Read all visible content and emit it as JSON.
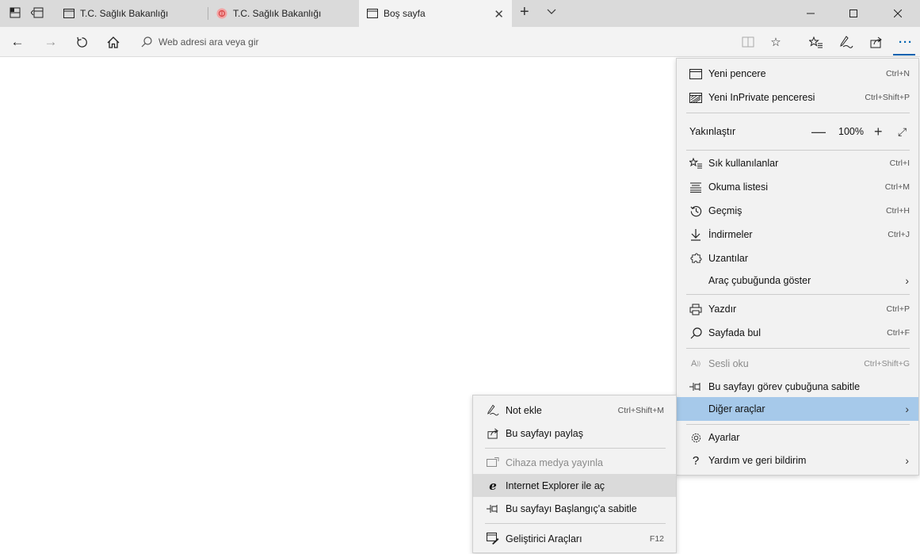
{
  "tabbar": {
    "tabs": [
      {
        "title": "T.C. Sağlık Bakanlığı"
      },
      {
        "title": "T.C. Sağlık Bakanlığı"
      },
      {
        "title": "Boş sayfa"
      }
    ],
    "accent_color": "#0063b1"
  },
  "address": {
    "placeholder": "Web adresi ara veya gir"
  },
  "menu": {
    "new_window": {
      "label": "Yeni pencere",
      "shortcut": "Ctrl+N"
    },
    "inprivate": {
      "label": "Yeni InPrivate penceresi",
      "shortcut": "Ctrl+Shift+P"
    },
    "zoom": {
      "label": "Yakınlaştır",
      "value": "100%"
    },
    "favorites": {
      "label": "Sık kullanılanlar",
      "shortcut": "Ctrl+I"
    },
    "reading_list": {
      "label": "Okuma listesi",
      "shortcut": "Ctrl+M"
    },
    "history": {
      "label": "Geçmiş",
      "shortcut": "Ctrl+H"
    },
    "downloads": {
      "label": "İndirmeler",
      "shortcut": "Ctrl+J"
    },
    "extensions": {
      "label": "Uzantılar"
    },
    "show_in_toolbar": {
      "label": "Araç çubuğunda göster"
    },
    "print": {
      "label": "Yazdır",
      "shortcut": "Ctrl+P"
    },
    "find": {
      "label": "Sayfada bul",
      "shortcut": "Ctrl+F"
    },
    "read_aloud": {
      "label": "Sesli oku",
      "shortcut": "Ctrl+Shift+G"
    },
    "pin_taskbar": {
      "label": "Bu sayfayı görev çubuğuna sabitle"
    },
    "more_tools": {
      "label": "Diğer araçlar"
    },
    "settings": {
      "label": "Ayarlar"
    },
    "help": {
      "label": "Yardım ve geri bildirim"
    }
  },
  "submenu": {
    "add_note": {
      "label": "Not ekle",
      "shortcut": "Ctrl+Shift+M"
    },
    "share": {
      "label": "Bu sayfayı paylaş"
    },
    "cast": {
      "label": "Cihaza medya yayınla"
    },
    "open_ie": {
      "label": "Internet Explorer ile aç"
    },
    "pin_start": {
      "label": "Bu sayfayı Başlangıç'a sabitle"
    },
    "dev_tools": {
      "label": "Geliştirici Araçları",
      "shortcut": "F12"
    }
  }
}
